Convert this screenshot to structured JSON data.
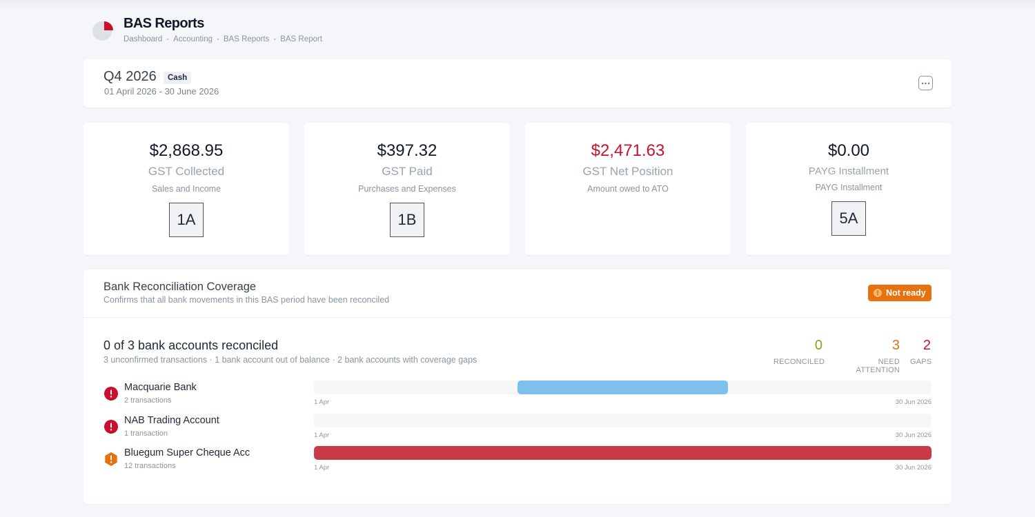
{
  "header": {
    "title": "BAS Reports",
    "logo_icon": "pie-chart-logo",
    "breadcrumb": [
      "Dashboard",
      "Accounting",
      "BAS Reports",
      "BAS Report"
    ],
    "breadcrumb_separator": "-"
  },
  "period": {
    "title": "Q4 2026",
    "badge": "Cash",
    "dates": "01 April 2026 - 30 June 2026",
    "menu_icon": "more-horizontal-icon"
  },
  "metrics": [
    {
      "value": "$2,868.95",
      "label": "GST Collected",
      "sub": "Sales and Income",
      "box": "1A",
      "value_color": "#111827"
    },
    {
      "value": "$397.32",
      "label": "GST Paid",
      "sub": "Purchases and Expenses",
      "box": "1B",
      "value_color": "#111827"
    },
    {
      "value": "$2,471.63",
      "label": "GST Net Position",
      "sub": "Amount owed to ATO",
      "value_color": "#c0152a"
    },
    {
      "value": "$0.00",
      "label": "PAYG Installment",
      "sub": "PAYG Installment",
      "box": "5A",
      "value_color": "#111827"
    }
  ],
  "reconciliation": {
    "title": "Bank Reconciliation Coverage",
    "description": "Confirms that all bank movements in this BAS period have been reconciled",
    "status": {
      "label": "Not ready",
      "icon": "alert-icon",
      "color": "#e6720e"
    },
    "summary_title": "0 of 3 bank accounts reconciled",
    "summary_desc": "3 unconfirmed transactions · 1 bank account out of balance · 2 bank accounts with coverage gaps",
    "stats": [
      {
        "value": "0",
        "label": "RECONCILED",
        "color": "#84a917"
      },
      {
        "value": "3",
        "label": "NEED ATTENTION",
        "color": "#e6720e"
      },
      {
        "value": "2",
        "label": "GAPS",
        "color": "#c0152a"
      }
    ],
    "accounts": [
      {
        "name": "Macquarie Bank",
        "count": "2 transactions",
        "icon": "error-circle-icon",
        "start": "1 Apr",
        "end": "30 Jun 2026",
        "coverage_start": 0.33,
        "coverage_end": 0.67,
        "bar_color": "#7cc0ee"
      },
      {
        "name": "NAB Trading Account",
        "count": "1 transaction",
        "icon": "error-circle-icon",
        "start": "1 Apr",
        "end": "30 Jun 2026",
        "coverage_start": 0,
        "coverage_end": 0,
        "bar_color": "#7cc0ee"
      },
      {
        "name": "Bluegum Super Cheque Acc",
        "count": "12 transactions",
        "icon": "warning-hexagon-icon",
        "start": "1 Apr",
        "end": "30 Jun 2026",
        "coverage_start": 0,
        "coverage_end": 1,
        "bar_color": "#c93a48"
      }
    ]
  }
}
